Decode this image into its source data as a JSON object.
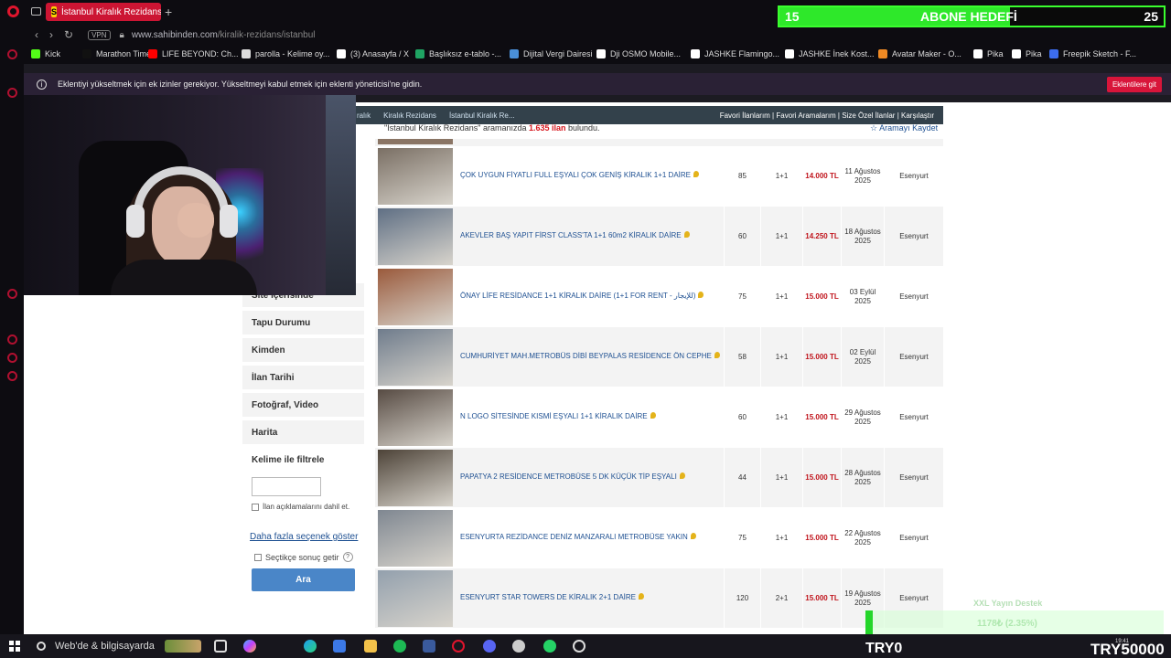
{
  "browser": {
    "tab_title": "İstanbul Kiralık Rezidans F",
    "tab_favicon": "S",
    "new_tab": "+",
    "vpn": "VPN",
    "url_domain": "www.sahibinden.com",
    "url_path": "/kiralik-rezidans/istanbul",
    "bookmarks": [
      {
        "label": "Kick",
        "color": "#53fc18"
      },
      {
        "label": "Marathon Timer",
        "color": "#111111"
      },
      {
        "label": "LIFE BEYOND: Ch...",
        "color": "#ff0000"
      },
      {
        "label": "parolla - Kelime oy...",
        "color": "#dddddd"
      },
      {
        "label": "(3) Anasayfa / X",
        "color": "#ffffff"
      },
      {
        "label": "Başlıksız e-tablo -...",
        "color": "#1fa463"
      },
      {
        "label": "Dijital Vergi Dairesi",
        "color": "#4a90d9"
      },
      {
        "label": "Dji OSMO Mobile...",
        "color": "#ffffff"
      },
      {
        "label": "JASHKE Flamingo...",
        "color": "#ffffff"
      },
      {
        "label": "JASHKE İnek Kost...",
        "color": "#ffffff"
      },
      {
        "label": "Avatar Maker - O...",
        "color": "#f08a24"
      },
      {
        "label": "Pika",
        "color": "#ffffff"
      },
      {
        "label": "Pika",
        "color": "#ffffff"
      },
      {
        "label": "Freepik Sketch - F...",
        "color": "#3c6df0"
      }
    ],
    "notice_text": "Eklentiyi yükseltmek için ek izinler gerekiyor. Yükseltmeyi kabul etmek için eklenti yöneticisi'ne gidin.",
    "notice_button": "Eklentilere git"
  },
  "page": {
    "breadcrumb": [
      "ralık",
      "Kiralık Rezidans",
      "İstanbul Kiralık Re..."
    ],
    "top_links": "Favori İlanlarım  |  Favori Aramalarım  |  Size Özel İlanlar  |  Karşılaştır",
    "result_prefix": "\"İstanbul Kiralık Rezidans\"",
    "result_middle": " aramanızda ",
    "result_count": "1.635 ilan",
    "result_suffix": " bulundu.",
    "save_search": "Aramayı Kaydet",
    "filters": [
      "Site İçerisinde",
      "Tapu Durumu",
      "Kimden",
      "İlan Tarihi",
      "Fotoğraf, Video",
      "Harita",
      "Kelime ile filtrele"
    ],
    "include_desc": "İlan açıklamalarını dahil et.",
    "more_options": "Daha fazla seçenek göster",
    "select_results": "Seçtikçe sonuç getir",
    "help": "?",
    "search_button": "Ara",
    "listings": [
      {
        "title": "ÇOK UYGUN FİYATLI FULL EŞYALI ÇOK GENİŞ KİRALIK 1+1 DAİRE",
        "m2": "85",
        "rooms": "1+1",
        "price": "14.000 TL",
        "date": "11 Ağustos 2025",
        "location": "Esenyurt",
        "thumb": "#7a6f64"
      },
      {
        "title": "AKEVLER BAŞ YAPIT FİRST CLASS'TA 1+1 60m2 KİRALIK DAİRE",
        "m2": "60",
        "rooms": "1+1",
        "price": "14.250 TL",
        "date": "18 Ağustos 2025",
        "location": "Esenyurt",
        "thumb": "#5f6f84"
      },
      {
        "title": "ÖNAY LİFE RESİDANCE 1+1 KİRALIK DAİRE (1+1 FOR RENT - للإيجار)",
        "m2": "75",
        "rooms": "1+1",
        "price": "15.000 TL",
        "date": "03 Eylül 2025",
        "location": "Esenyurt",
        "thumb": "#9a5a3c"
      },
      {
        "title": "CUMHURİYET MAH.METROBÜS DİBİ BEYPALAS RESİDENCE ÖN CEPHE",
        "m2": "58",
        "rooms": "1+1",
        "price": "15.000 TL",
        "date": "02 Eylül 2025",
        "location": "Esenyurt",
        "thumb": "#6f7c8c"
      },
      {
        "title": "N LOGO SİTESİNDE KISMİ EŞYALI 1+1 KİRALIK DAİRE",
        "m2": "60",
        "rooms": "1+1",
        "price": "15.000 TL",
        "date": "29 Ağustos 2025",
        "location": "Esenyurt",
        "thumb": "#574b43"
      },
      {
        "title": "PAPATYA 2 RESİDENCE METROBÜSE 5 DK KÜÇÜK TİP EŞYALI",
        "m2": "44",
        "rooms": "1+1",
        "price": "15.000 TL",
        "date": "28 Ağustos 2025",
        "location": "Esenyurt",
        "thumb": "#4d4338"
      },
      {
        "title": "ESENYURTA REZİDANCE DENİZ MANZARALI METROBÜSE YAKIN",
        "m2": "75",
        "rooms": "1+1",
        "price": "15.000 TL",
        "date": "22 Ağustos 2025",
        "location": "Esenyurt",
        "thumb": "#7f8791"
      },
      {
        "title": "ESENYURT STAR TOWERS DE KİRALIK 2+1 DAİRE",
        "m2": "120",
        "rooms": "2+1",
        "price": "15.000 TL",
        "date": "19 Ağustos 2025",
        "location": "Esenyurt",
        "thumb": "#93a0ad"
      }
    ]
  },
  "overlay": {
    "goal_current": "15",
    "goal_label": "ABONE HEDEFİ",
    "goal_target": "25",
    "goal_progress": 0.6,
    "donation_title": "XXL Yayın Destek",
    "donation_value": "1178₺ (2.35%)",
    "try_left": "TRY0",
    "try_right": "TRY50000"
  },
  "taskbar": {
    "search_placeholder": "Web'de & bilgisayarda",
    "time": "19:41"
  }
}
